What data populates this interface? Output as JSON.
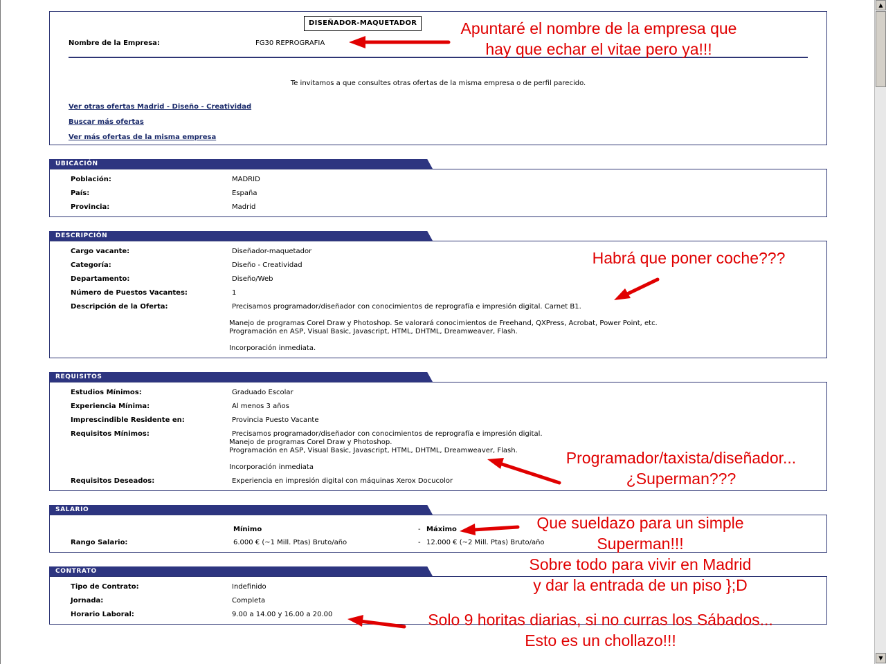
{
  "header": {
    "job_title": "DISEÑADOR-MAQUETADOR",
    "company_label": "Nombre de la Empresa:",
    "company_value": "FG30 REPROGRAFIA",
    "invite_text": "Te invitamos a que consultes otras ofertas de la misma empresa o de perfil parecido.",
    "links": [
      "Ver otras ofertas Madrid - Diseño - Creatividad",
      "Buscar más ofertas",
      "Ver más ofertas de la misma empresa"
    ]
  },
  "ubicacion": {
    "title": "UBICACIÓN",
    "rows": [
      {
        "label": "Población:",
        "value": "MADRID"
      },
      {
        "label": "País:",
        "value": "España"
      },
      {
        "label": "Provincia:",
        "value": "Madrid"
      }
    ]
  },
  "descripcion": {
    "title": "DESCRIPCIÓN",
    "rows": [
      {
        "label": "Cargo vacante:",
        "value": "Diseñador-maquetador"
      },
      {
        "label": "Categoría:",
        "value": "Diseño - Creatividad"
      },
      {
        "label": "Departamento:",
        "value": "Diseño/Web"
      },
      {
        "label": "Número de Puestos Vacantes:",
        "value": "1"
      },
      {
        "label": "Descripción de la Oferta:",
        "value": "Precisamos programador/diseñador con conocimientos de reprografía e impresión digital. Carnet B1."
      }
    ],
    "extra_lines": [
      "Manejo de programas Corel Draw y Photoshop. Se valorará conocimientos de Freehand, QXPress, Acrobat, Power Point, etc.",
      "Programación en ASP, Visual Basic, Javascript, HTML, DHTML, Dreamweaver, Flash.",
      "Incorporación inmediata."
    ]
  },
  "requisitos": {
    "title": "REQUISITOS",
    "rows": [
      {
        "label": "Estudios Mínimos:",
        "value": "Graduado Escolar"
      },
      {
        "label": "Experiencia Mínima:",
        "value": "Al menos 3 años"
      },
      {
        "label": "Imprescindible Residente en:",
        "value": "Provincia Puesto Vacante"
      },
      {
        "label": "Requisitos Mínimos:",
        "value": "Precisamos programador/diseñador con conocimientos de reprografía e impresión digital."
      }
    ],
    "extra_lines": [
      "Manejo de programas Corel Draw y Photoshop.",
      "Programación en ASP, Visual Basic, Javascript, HTML, DHTML, Dreamweaver, Flash.",
      "Incorporación inmediata"
    ],
    "deseados_label": "Requisitos Deseados:",
    "deseados_value": "Experiencia en impresión digital con máquinas Xerox Docucolor"
  },
  "salario": {
    "title": "SALARIO",
    "min_header": "Mínimo",
    "max_header": "Máximo",
    "dash": "-",
    "range_label": "Rango Salario:",
    "min_value": "6.000 € (~1 Mill. Ptas) Bruto/año",
    "max_value": "12.000 € (~2 Mill. Ptas) Bruto/año"
  },
  "contrato": {
    "title": "CONTRATO",
    "rows": [
      {
        "label": "Tipo de Contrato:",
        "value": "Indefinido"
      },
      {
        "label": "Jornada:",
        "value": "Completa"
      },
      {
        "label": "Horario Laboral:",
        "value": "9.00 a 14.00 y 16.00 a 20.00"
      }
    ]
  },
  "annotations": {
    "a1_l1": "Apuntaré el nombre de la empresa que",
    "a1_l2": "hay que echar el vitae pero ya!!!",
    "a2": "Habrá que poner coche???",
    "a3_l1": "Programador/taxista/diseñador...",
    "a3_l2": "¿Superman???",
    "a4_l1": "Que sueldazo para un simple",
    "a4_l2": "Superman!!!",
    "a4_l3": "Sobre todo para vivir en Madrid",
    "a4_l4": "y dar la entrada de un piso };D",
    "a5_l1": "Solo 9 horitas diarias, si no curras los Sábados...",
    "a5_l2": "Esto es un chollazo!!!"
  },
  "colors": {
    "accent": "#2d3580",
    "annotation": "#e00000"
  }
}
